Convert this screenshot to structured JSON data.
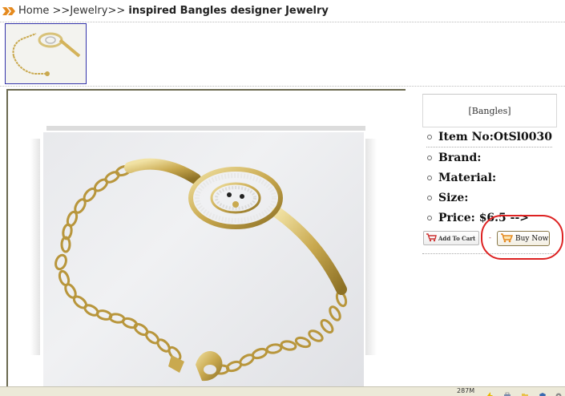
{
  "breadcrumb": {
    "home": "Home",
    "sep1": ">>",
    "jewelry": "Jewelry",
    "sep2": ">>",
    "current": "inspired Bangles designer  Jewelry"
  },
  "category": {
    "label": "[Bangles]"
  },
  "specs": [
    {
      "label": "Item No:OtSl0030"
    },
    {
      "label": "Brand:"
    },
    {
      "label": "Material:"
    },
    {
      "label": "Size:"
    },
    {
      "label": "Price: $6.5   -->"
    }
  ],
  "buttons": {
    "add_to_cart": "Add To Cart",
    "separator": "-",
    "buy_now": "Buy Now"
  },
  "statusbar": {
    "count": "287M"
  },
  "colors": {
    "frame": "#6b6a50",
    "thumb_border": "#3333aa",
    "highlight": "#dd2222",
    "gold": "#c9a94f"
  }
}
